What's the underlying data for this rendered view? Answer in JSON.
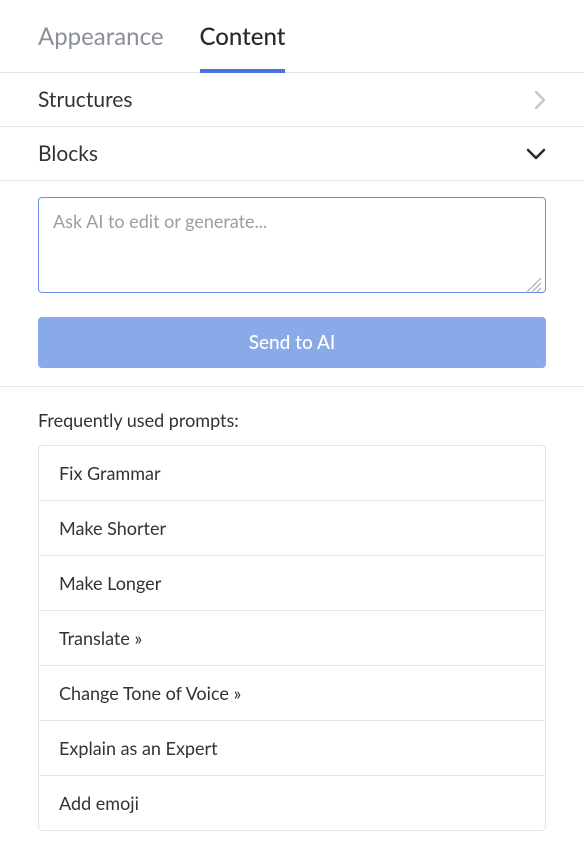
{
  "tabs": {
    "appearance": "Appearance",
    "content": "Content"
  },
  "accordion": {
    "structures": "Structures",
    "blocks": "Blocks"
  },
  "ai": {
    "placeholder": "Ask AI to edit or generate...",
    "send_label": "Send to AI"
  },
  "prompts": {
    "heading": "Frequently used prompts:",
    "items": [
      "Fix Grammar",
      "Make Shorter",
      "Make Longer",
      "Translate »",
      "Change Tone of Voice »",
      "Explain as an Expert",
      "Add emoji"
    ]
  }
}
